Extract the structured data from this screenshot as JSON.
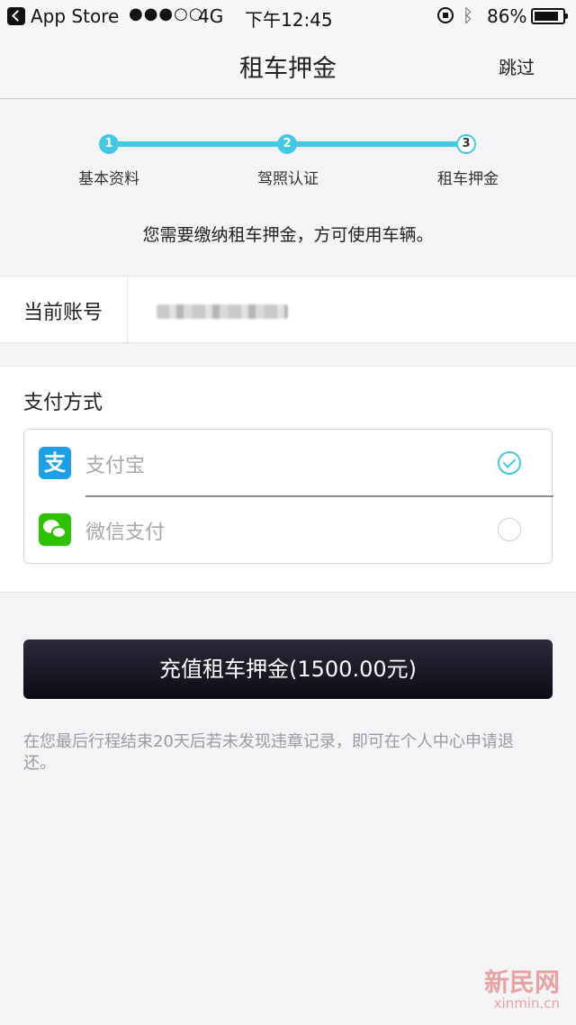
{
  "status_bar": {
    "back_app": "App Store",
    "signal": "●●●○○",
    "carrier": "4G",
    "time": "下午12:45",
    "battery_percent": "86%",
    "battery_level": 0.86
  },
  "nav": {
    "title": "租车押金",
    "skip": "跳过"
  },
  "stepper": {
    "steps": [
      {
        "number": "1",
        "label": "基本资料",
        "state": "done"
      },
      {
        "number": "2",
        "label": "驾照认证",
        "state": "done"
      },
      {
        "number": "3",
        "label": "租车押金",
        "state": "current"
      }
    ],
    "accent_color": "#43c8e4",
    "notice": "您需要缴纳租车押金，方可使用车辆。"
  },
  "account": {
    "label": "当前账号",
    "value_masked": true
  },
  "payment": {
    "section_title": "支付方式",
    "options": [
      {
        "label": "支付宝",
        "icon": "alipay-icon",
        "selected": true
      },
      {
        "label": "微信支付",
        "icon": "wechat-icon",
        "selected": false
      }
    ]
  },
  "recharge_button": "充值租车押金(1500.00元)",
  "refund_note": "在您最后行程结束20天后若未发现违章记录，即可在个人中心申请退还。",
  "watermark": {
    "cn": "新民网",
    "en": "xinmin.cn"
  }
}
